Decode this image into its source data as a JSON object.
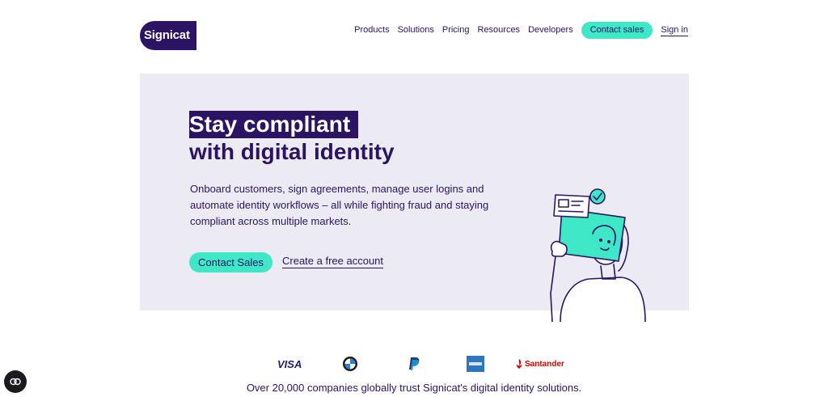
{
  "header": {
    "logo_text": "Signicat",
    "nav": [
      {
        "label": "Products"
      },
      {
        "label": "Solutions"
      },
      {
        "label": "Pricing"
      },
      {
        "label": "Resources"
      },
      {
        "label": "Developers"
      }
    ],
    "cta_label": "Contact sales",
    "signin_label": "Sign in"
  },
  "hero": {
    "title_highlight": "Stay compliant",
    "title_rest": "with digital identity",
    "description": "Onboard customers, sign agreements, manage user logins and automate identity workflows – all while fighting fraud and staying compliant across multiple markets.",
    "primary_button": "Contact Sales",
    "secondary_link": "Create a free account",
    "illustration_icon": "person-holding-id-icon"
  },
  "logos": {
    "visa": "VISA",
    "santander": "Santander",
    "bmw_icon": "bmw-logo-icon",
    "paypal_icon": "paypal-logo-icon",
    "amex_icon": "amex-logo-icon",
    "santander_icon": "santander-flame-icon"
  },
  "trust_text": "Over 20,000 companies globally trust Signicat's digital identity solutions.",
  "cookie_icon": "cookie-settings-icon",
  "colors": {
    "brand": "#2b1463",
    "accent": "#3ee8c6",
    "hero_bg": "#ecebf3"
  }
}
